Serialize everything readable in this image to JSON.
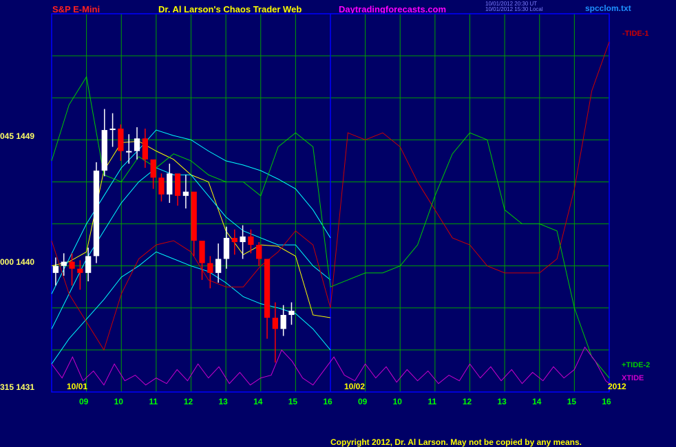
{
  "header": {
    "instrument": "S&P E-Mini",
    "title": "Dr. Al Larson's Chaos Trader Web",
    "site": "Daytradingforecasts.com",
    "stamp_line1": "10/01/2012 20:30 UT",
    "stamp_line2": "10/01/2012 15:30 Local",
    "file": "spcclom.txt"
  },
  "y_labels": [
    {
      "text": "045  1449"
    },
    {
      "text": "000  1440"
    },
    {
      "text": "315  1431"
    }
  ],
  "copyright": "Copyright 2012, Dr. Al Larson. May not be copied by any means.",
  "colors": {
    "background": "#000066",
    "grid": "#00a000",
    "plot_border": "#0000ff",
    "price_up": "#ffffff",
    "price_down": "#ff0000",
    "average": "#ffff00",
    "band": "#00ffff",
    "tide1": "#cc0000",
    "tide2": "#00cc00",
    "xtide": "#cc00cc",
    "hour_labels": "#00ff00",
    "date_labels": "#ffff00"
  },
  "chart_data": {
    "type": "line",
    "ylim": [
      1431,
      1458
    ],
    "y_ticks": [
      1431,
      1434,
      1437,
      1440,
      1443,
      1446,
      1449,
      1452,
      1455
    ],
    "x_tick_labels": [
      "09",
      "10",
      "11",
      "12",
      "13",
      "14",
      "15",
      "16",
      "09",
      "10",
      "11",
      "12",
      "13",
      "14",
      "15",
      "16"
    ],
    "date_labels": [
      "10/01",
      "10/02",
      "2012"
    ],
    "price_bars": {
      "open": [
        1439.5,
        1440.0,
        1440.3,
        1439.8,
        1439.5,
        1440.7,
        1446.8,
        1449.7,
        1449.8,
        1448.2,
        1448.2,
        1449.1,
        1447.6,
        1446.3,
        1445.1,
        1446.6,
        1445.0,
        1445.3,
        1441.8,
        1440.2,
        1439.5,
        1440.5,
        1442.0,
        1441.7,
        1442.1,
        1441.5,
        1440.5,
        1436.3,
        1435.5,
        1436.5
      ],
      "close": [
        1440.0,
        1440.3,
        1439.8,
        1439.5,
        1440.7,
        1446.8,
        1449.7,
        1449.8,
        1448.2,
        1448.2,
        1449.1,
        1447.6,
        1446.3,
        1445.1,
        1446.6,
        1445.0,
        1445.3,
        1441.8,
        1440.2,
        1439.5,
        1440.5,
        1442.0,
        1441.7,
        1442.1,
        1441.5,
        1440.5,
        1436.3,
        1435.5,
        1436.5,
        1436.8
      ],
      "high": [
        1440.6,
        1440.9,
        1440.9,
        1440.4,
        1441.3,
        1447.4,
        1451.2,
        1450.9,
        1450.1,
        1449.4,
        1449.9,
        1449.8,
        1447.3,
        1446.6,
        1447.3,
        1446.0,
        1446.5,
        1442.7,
        1441.6,
        1440.7,
        1441.6,
        1442.8,
        1442.6,
        1442.9,
        1442.6,
        1441.7,
        1438.2,
        1437.4,
        1437.2,
        1437.4
      ],
      "low": [
        1438.6,
        1439.3,
        1438.6,
        1438.3,
        1438.9,
        1440.2,
        1446.4,
        1448.5,
        1447.5,
        1447.3,
        1447.6,
        1447.0,
        1445.5,
        1444.6,
        1444.5,
        1444.3,
        1444.1,
        1440.7,
        1439.0,
        1438.4,
        1438.8,
        1439.8,
        1440.8,
        1440.5,
        1440.9,
        1440.0,
        1434.8,
        1433.1,
        1435.0,
        1435.8
      ]
    },
    "series": [
      {
        "x": [
          0,
          0.5,
          1,
          1.5,
          2,
          2.5,
          3,
          3.5,
          4,
          4.5,
          5,
          5.5,
          6,
          6.5,
          7,
          7.5,
          8
        ],
        "values": [
          1440.0,
          1440.3,
          1441.0,
          1446.8,
          1448.8,
          1448.9,
          1448.2,
          1447.6,
          1446.5,
          1446.0,
          1442.5,
          1440.8,
          1441.5,
          1441.4,
          1440.7,
          1436.5,
          1436.3
        ]
      },
      {
        "x": [
          0,
          0.5,
          1,
          1.5,
          2,
          2.5,
          3,
          3.5,
          4,
          4.5,
          5,
          5.5,
          6,
          6.5,
          7,
          7.5,
          8
        ],
        "values": [
          1435.5,
          1438.0,
          1440.5,
          1442.5,
          1444.5,
          1446.0,
          1447.0,
          1446.5,
          1446.5,
          1445.0,
          1443.5,
          1442.5,
          1442.0,
          1441.5,
          1441.5,
          1440.0,
          1439.0
        ]
      },
      {
        "x": [
          0,
          0.5,
          1,
          1.5,
          2,
          2.5,
          3,
          3.5,
          4,
          4.5,
          5,
          5.5,
          6,
          6.5,
          7,
          7.5,
          8
        ],
        "values": [
          1433.0,
          1434.8,
          1436.2,
          1437.6,
          1439.2,
          1440.0,
          1441.0,
          1440.5,
          1440.0,
          1439.6,
          1438.8,
          1437.8,
          1437.3,
          1437.0,
          1436.6,
          1435.5,
          1434.0
        ]
      },
      {
        "x": [
          0,
          0.5,
          1,
          1.5,
          2,
          2.5,
          3,
          3.5,
          4,
          4.5,
          5,
          5.5,
          6,
          6.5,
          7,
          7.5,
          8
        ],
        "values": [
          1438.0,
          1440.5,
          1443.0,
          1445.0,
          1447.0,
          1448.3,
          1449.7,
          1449.3,
          1449.0,
          1448.2,
          1447.5,
          1447.2,
          1446.8,
          1446.2,
          1445.5,
          1444.0,
          1442.0
        ]
      },
      {
        "name": "-TIDE-1",
        "x": [
          0,
          0.5,
          1,
          1.5,
          2,
          2.5,
          3,
          3.5,
          4,
          4.5,
          5,
          5.5,
          6,
          6.5,
          7,
          7.5,
          8,
          8.5,
          9,
          9.5,
          10,
          10.5,
          11,
          11.5,
          12,
          12.5,
          13,
          13.5,
          14,
          14.5,
          15,
          15.5,
          16
        ],
        "values": [
          1441.8,
          1438.0,
          1436.0,
          1434.0,
          1438.0,
          1440.5,
          1441.5,
          1441.8,
          1441.0,
          1439.0,
          1438.5,
          1438.5,
          1440.0,
          1441.0,
          1442.5,
          1441.5,
          1437.0,
          1449.5,
          1449.0,
          1449.5,
          1448.5,
          1446.0,
          1444.0,
          1442.0,
          1441.5,
          1440.0,
          1439.5,
          1439.5,
          1439.5,
          1440.5,
          1445.5,
          1452.5,
          1456.0
        ]
      },
      {
        "name": "+TIDE-2",
        "x": [
          0,
          0.5,
          1,
          1.5,
          2,
          2.5,
          3,
          3.5,
          4,
          4.5,
          5,
          5.5,
          6,
          6.5,
          7,
          7.5,
          8,
          8.5,
          9,
          9.5,
          10,
          10.5,
          11,
          11.5,
          12,
          12.5,
          13,
          13.5,
          14,
          14.5,
          15,
          15.5,
          16
        ],
        "values": [
          1447.5,
          1451.5,
          1453.5,
          1446.5,
          1446.0,
          1447.8,
          1447.0,
          1448.0,
          1447.5,
          1446.5,
          1446.0,
          1446.0,
          1445.0,
          1448.5,
          1449.5,
          1448.5,
          1438.5,
          1439.0,
          1439.5,
          1439.5,
          1440.0,
          1441.5,
          1445.0,
          1448.0,
          1449.5,
          1449.0,
          1444.0,
          1443.0,
          1443.0,
          1442.5,
          1437.0,
          1433.5,
          1432.0
        ]
      },
      {
        "name": "XTIDE",
        "x": [
          0,
          0.3,
          0.6,
          0.9,
          1.2,
          1.5,
          1.8,
          2.1,
          2.4,
          2.7,
          3.0,
          3.3,
          3.6,
          3.9,
          4.2,
          4.5,
          4.8,
          5.1,
          5.4,
          5.7,
          6.0,
          6.3,
          6.6,
          6.9,
          7.2,
          7.5,
          7.8,
          8.1,
          8.4,
          8.7,
          9.0,
          9.3,
          9.6,
          9.9,
          10.2,
          10.5,
          10.8,
          11.1,
          11.4,
          11.7,
          12.0,
          12.3,
          12.6,
          12.9,
          13.2,
          13.5,
          13.8,
          14.1,
          14.4,
          14.7,
          15.0,
          15.3,
          15.6,
          15.9,
          16.0
        ],
        "values": [
          1433.0,
          1432.0,
          1433.5,
          1431.8,
          1432.5,
          1431.5,
          1433.0,
          1431.8,
          1432.2,
          1431.5,
          1432.0,
          1431.6,
          1432.6,
          1431.8,
          1433.0,
          1432.0,
          1432.8,
          1431.6,
          1432.4,
          1431.5,
          1432.0,
          1432.2,
          1434.0,
          1433.2,
          1432.0,
          1431.5,
          1432.5,
          1433.5,
          1432.2,
          1431.8,
          1433.0,
          1432.0,
          1432.8,
          1431.7,
          1432.6,
          1431.8,
          1432.5,
          1431.6,
          1432.2,
          1431.8,
          1433.0,
          1432.0,
          1432.8,
          1431.8,
          1432.6,
          1431.6,
          1432.4,
          1431.8,
          1432.8,
          1432.0,
          1432.6,
          1434.2,
          1433.2,
          1431.8,
          1431.6
        ]
      }
    ]
  }
}
